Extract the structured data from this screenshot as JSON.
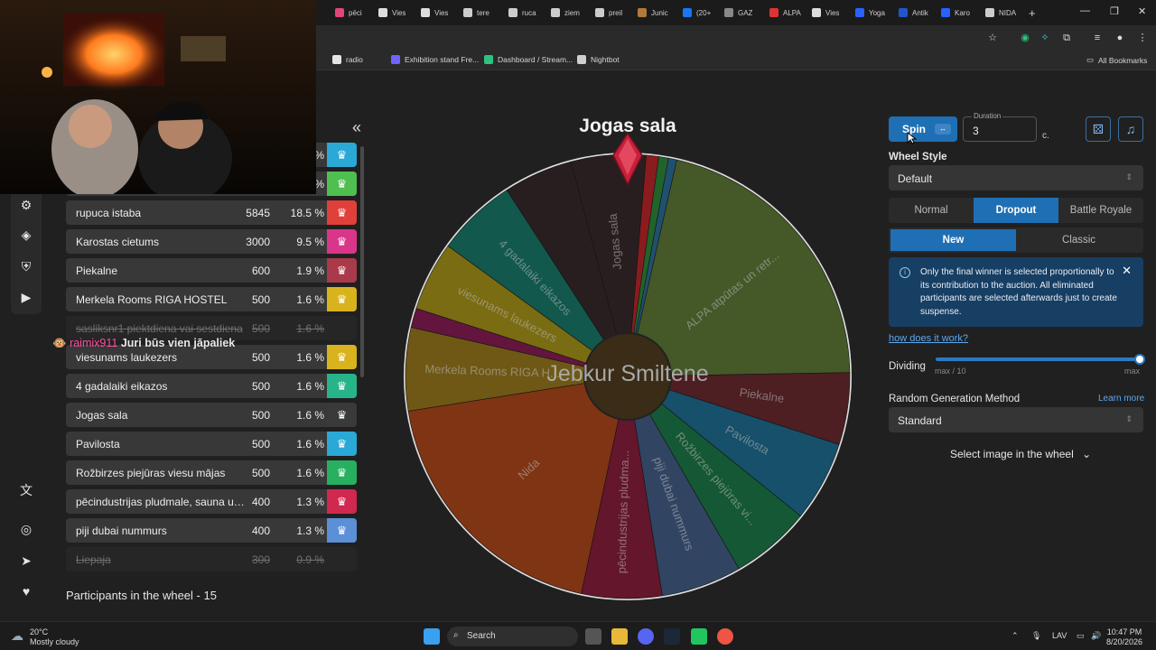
{
  "browser": {
    "tabs": [
      {
        "label": "pēci",
        "color": "#e0457b"
      },
      {
        "label": "Vies",
        "color": "#dddddd"
      },
      {
        "label": "Vies",
        "color": "#dddddd"
      },
      {
        "label": "tere",
        "color": "#cccccc"
      },
      {
        "label": "ruca",
        "color": "#cccccc"
      },
      {
        "label": "ziem",
        "color": "#cccccc"
      },
      {
        "label": "preil",
        "color": "#cccccc"
      },
      {
        "label": "Junic",
        "color": "#b07a3a"
      },
      {
        "label": "(20+",
        "color": "#1877f2"
      },
      {
        "label": "GAZ",
        "color": "#888888"
      },
      {
        "label": "ALPA",
        "color": "#d33"
      },
      {
        "label": "Vies",
        "color": "#dddddd"
      },
      {
        "label": "Yoga",
        "color": "#2962ff"
      },
      {
        "label": "Antik",
        "color": "#2255cc"
      },
      {
        "label": "Karo",
        "color": "#2962ff"
      },
      {
        "label": "NIDA",
        "color": "#cccccc"
      }
    ],
    "bookmarks": [
      {
        "label": "radio",
        "color": "#e5e5e5"
      },
      {
        "label": "Exhibition stand Fre...",
        "color": "#6f63ff"
      },
      {
        "label": "Dashboard / Stream...",
        "color": "#2ec27e"
      },
      {
        "label": "Nightbot",
        "color": "#cfcfcf"
      }
    ],
    "all_bookmarks": "All Bookmarks"
  },
  "list": {
    "rows": [
      {
        "name": "",
        "amount": "",
        "percent": "%",
        "color": "#2aa8d6",
        "struck": false
      },
      {
        "name": "",
        "amount": "",
        "percent": "%",
        "color": "#4fbf4f",
        "struck": false
      },
      {
        "name": "rupuca istaba",
        "amount": "5845",
        "percent": "18.5 %",
        "color": "#e0403a",
        "struck": false
      },
      {
        "name": "Karostas cietums",
        "amount": "3000",
        "percent": "9.5 %",
        "color": "#d9368a",
        "struck": false
      },
      {
        "name": "Piekalne",
        "amount": "600",
        "percent": "1.9 %",
        "color": "#a83a4a",
        "struck": false
      },
      {
        "name": "Merkela Rooms RIGA HOSTEL",
        "amount": "500",
        "percent": "1.6 %",
        "color": "#d8b31e",
        "struck": false
      },
      {
        "name": "sasliksnr1 piektdiena vai sestdiena",
        "amount": "500",
        "percent": "1.6 %",
        "color": "#262626",
        "struck": true
      },
      {
        "name": "viesunams laukezers",
        "amount": "500",
        "percent": "1.6 %",
        "color": "#d8b31e",
        "struck": false
      },
      {
        "name": "4 gadalaiki eikazos",
        "amount": "500",
        "percent": "1.6 %",
        "color": "#27b48a",
        "struck": false
      },
      {
        "name": "Jogas sala",
        "amount": "500",
        "percent": "1.6 %",
        "color": "#3a3a3a",
        "struck": false
      },
      {
        "name": "Pavilosta",
        "amount": "500",
        "percent": "1.6 %",
        "color": "#2aa8d6",
        "struck": false
      },
      {
        "name": "Rožbirzes piejūras viesu mājas",
        "amount": "500",
        "percent": "1.6 %",
        "color": "#27b060",
        "struck": false
      },
      {
        "name": "pēcindustrijas pludmale, sauna un ...",
        "amount": "400",
        "percent": "1.3 %",
        "color": "#d0284e",
        "struck": false
      },
      {
        "name": "piji dubai nummurs",
        "amount": "400",
        "percent": "1.3 %",
        "color": "#5b8fd6",
        "struck": false
      },
      {
        "name": "Liepaja",
        "amount": "300",
        "percent": "0.9 %",
        "color": "#262626",
        "struck": true
      }
    ],
    "participants": "Participants in the wheel - 15"
  },
  "chat": {
    "user": "raimix911",
    "message": "Juri būs vien jāpaliek"
  },
  "wheel": {
    "title": "Jogas sala",
    "center_text": "Jebkur Smiltene",
    "segments": [
      {
        "label": "Jogas sala",
        "share": 5.4,
        "color": "#3a2a2c"
      },
      {
        "label": "",
        "share": 0.9,
        "color": "#c0262c"
      },
      {
        "label": "",
        "share": 0.7,
        "color": "#2f8a3a"
      },
      {
        "label": "",
        "share": 0.6,
        "color": "#2d6f9a"
      },
      {
        "label": "ALPA atpūtas un retr...",
        "share": 21.0,
        "color": "#5f7a38"
      },
      {
        "label": "Piekalne",
        "share": 5.2,
        "color": "#6b2a30"
      },
      {
        "label": "Pavilosta",
        "share": 5.8,
        "color": "#1f6f93"
      },
      {
        "label": "Rožbirzes piejūras vi...",
        "share": 5.8,
        "color": "#1e7a4a"
      },
      {
        "label": "piji dubai nummurs",
        "share": 5.8,
        "color": "#44608a"
      },
      {
        "label": "pēcindustrijas pludma...",
        "share": 5.8,
        "color": "#8a1f3e"
      },
      {
        "label": "Nida",
        "share": 19.0,
        "color": "#b0481c"
      },
      {
        "label": "Merkela Rooms RIGA H...",
        "share": 6.0,
        "color": "#9a7a1e"
      },
      {
        "label": "",
        "share": 1.4,
        "color": "#8a1e55"
      },
      {
        "label": "viesunams laukezers",
        "share": 5.0,
        "color": "#a8961a"
      },
      {
        "label": "4 gadalaiki eikazos",
        "share": 5.8,
        "color": "#1a7a6a"
      },
      {
        "label": "",
        "share": 5.0,
        "color": "#3a2a2c"
      }
    ]
  },
  "controls": {
    "spin": "Spin",
    "spin_kbd": "↔",
    "duration_label": "Duration",
    "duration_value": "3",
    "unit": "c.",
    "wheel_style_label": "Wheel Style",
    "wheel_style_value": "Default",
    "modes": [
      "Normal",
      "Dropout",
      "Battle Royale"
    ],
    "active_mode": 1,
    "variants": [
      "New",
      "Classic"
    ],
    "active_variant": 0,
    "info_text": "Only the final winner is selected proportionally to its contribution to the auction. All eliminated participants are selected afterwards just to create suspense.",
    "how_link": "how does it work?",
    "dividing_label": "Dividing",
    "slider_min": "max / 10",
    "slider_max": "max",
    "slider_value": 1.0,
    "rng_label": "Random Generation Method",
    "learn_more": "Learn more",
    "rng_value": "Standard",
    "select_image": "Select image in the wheel"
  },
  "taskbar": {
    "temp": "20°C",
    "weather": "Mostly cloudy",
    "search": "Search",
    "lang": "LAV",
    "time": "10:47 PM",
    "date": "8/20/2026"
  }
}
